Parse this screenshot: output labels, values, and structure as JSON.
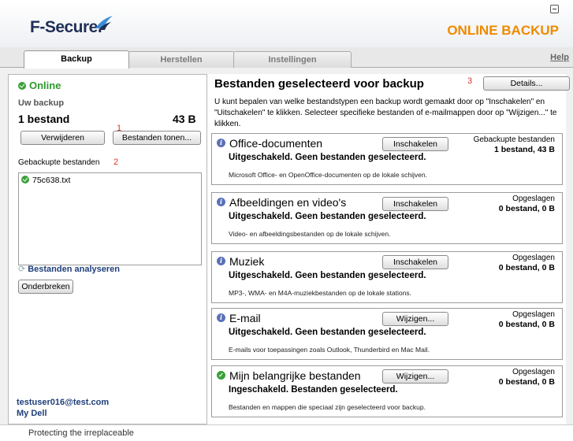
{
  "header": {
    "logo_text": "F-Secure.",
    "product_name": "ONLINE BACKUP",
    "brand_color": "#f08a00"
  },
  "tabs": [
    {
      "label": "Backup",
      "active": true
    },
    {
      "label": "Herstellen",
      "active": false
    },
    {
      "label": "Instellingen",
      "active": false
    }
  ],
  "help_label": "Help",
  "left": {
    "status": "Online",
    "backup_heading": "Uw backup",
    "file_count": "1 bestand",
    "file_size": "43 B",
    "delete_button": "Verwijderen",
    "show_files_button": "Bestanden tonen...",
    "backed_up_label": "Gebackupte bestanden",
    "files": [
      "75c638.txt"
    ],
    "analyze_label": "Bestanden analyseren",
    "interrupt_button": "Onderbreken",
    "account_email": "testuser016@test.com",
    "account_name": "My Dell"
  },
  "annotations": {
    "a1": "1",
    "a2": "2",
    "a3": "3"
  },
  "right": {
    "title": "Bestanden geselecteerd voor backup",
    "details_button": "Details...",
    "description": "U kunt bepalen van welke bestandstypen een backup wordt gemaakt door op \"Inschakelen\" en \"Uitschakelen\" te klikken. Selecteer specifieke bestanden of e-mailmappen door op \"Wijzigen...\" te klikken.",
    "categories": [
      {
        "title": "Office-documenten",
        "button": "Inschakelen",
        "state": "Uitgeschakeld. Geen bestanden geselecteerd.",
        "note": "Microsoft Office- en OpenOffice-documenten op de lokale schijven.",
        "stat_label": "Gebackupte bestanden",
        "stat_value": "1 bestand, 43 B",
        "icon": "info-icon"
      },
      {
        "title": "Afbeeldingen en video's",
        "button": "Inschakelen",
        "state": "Uitgeschakeld. Geen bestanden geselecteerd.",
        "note": "Video- en afbeeldingsbestanden op de lokale schijven.",
        "stat_label": "Opgeslagen",
        "stat_value": "0 bestand, 0 B",
        "icon": "info-icon"
      },
      {
        "title": "Muziek",
        "button": "Inschakelen",
        "state": "Uitgeschakeld. Geen bestanden geselecteerd.",
        "note": "MP3-, WMA- en M4A-muziekbestanden op de lokale stations.",
        "stat_label": "Opgeslagen",
        "stat_value": "0 bestand, 0 B",
        "icon": "info-icon"
      },
      {
        "title": "E-mail",
        "button": "Wijzigen...",
        "state": "Uitgeschakeld. Geen bestanden geselecteerd.",
        "note": "E-mails voor toepassingen zoals Outlook, Thunderbird en Mac Mail.",
        "stat_label": "Opgeslagen",
        "stat_value": "0 bestand, 0 B",
        "icon": "info-icon"
      },
      {
        "title": "Mijn belangrijke bestanden",
        "button": "Wijzigen...",
        "state": "Ingeschakeld. Bestanden geselecteerd.",
        "note": "Bestanden en mappen die speciaal zijn geselecteerd voor backup.",
        "stat_label": "Opgeslagen",
        "stat_value": "0 bestand, 0 B",
        "icon": "check-icon"
      }
    ]
  },
  "footer": {
    "tagline": "Protecting the irreplaceable"
  }
}
